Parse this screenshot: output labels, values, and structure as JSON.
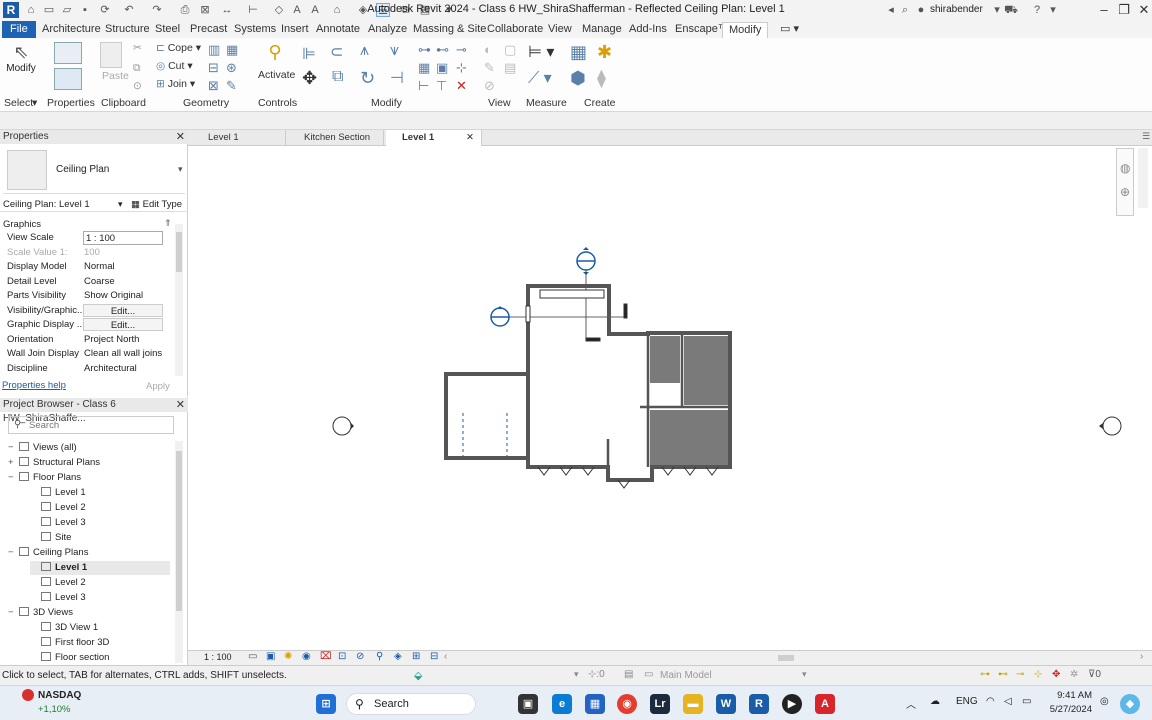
{
  "window": {
    "title": "Autodesk Revit 2024 - Class 6 HW_ShiraShafferman - Reflected Ceiling Plan: Level 1",
    "user": "shirabender"
  },
  "ribbon_tabs": [
    "File",
    "Architecture",
    "Structure",
    "Steel",
    "Precast",
    "Systems",
    "Insert",
    "Annotate",
    "Analyze",
    "Massing & Site",
    "Collaborate",
    "View",
    "Manage",
    "Add-Ins",
    "Enscape™",
    "Modify"
  ],
  "ribbon": {
    "select": {
      "label": "Select",
      "modify": "Modify"
    },
    "properties": "Properties",
    "clipboard": {
      "label": "Clipboard",
      "paste": "Paste"
    },
    "geometry": {
      "label": "Geometry",
      "cope": "Cope",
      "cut": "Cut",
      "join": "Join"
    },
    "controls": {
      "label": "Controls",
      "activate": "Activate"
    },
    "modify": "Modify",
    "view": "View",
    "measure": "Measure",
    "create": "Create"
  },
  "properties": {
    "header": "Properties",
    "type_name": "Ceiling Plan",
    "instance": "Ceiling Plan: Level 1",
    "edit_type": "Edit Type",
    "section": "Graphics",
    "rows": [
      {
        "k": "View Scale",
        "v": "1 : 100"
      },
      {
        "k": "Scale Value    1:",
        "v": "100"
      },
      {
        "k": "Display Model",
        "v": "Normal"
      },
      {
        "k": "Detail Level",
        "v": "Coarse"
      },
      {
        "k": "Parts Visibility",
        "v": "Show Original"
      },
      {
        "k": "Visibility/Graphic...",
        "v": "Edit..."
      },
      {
        "k": "Graphic Display ...",
        "v": "Edit..."
      },
      {
        "k": "Orientation",
        "v": "Project North"
      },
      {
        "k": "Wall Join Display",
        "v": "Clean all wall joins"
      },
      {
        "k": "Discipline",
        "v": "Architectural"
      }
    ],
    "help": "Properties help",
    "apply": "Apply"
  },
  "browser": {
    "header": "Project Browser - Class 6 HW_ShiraShaffe...",
    "search_placeholder": "Search",
    "nodes": [
      {
        "label": "Views (all)",
        "sign": "−"
      },
      {
        "label": "Structural Plans",
        "sign": "+"
      },
      {
        "label": "Floor Plans",
        "sign": "−"
      },
      {
        "label": "Level 1",
        "sign": ""
      },
      {
        "label": "Level 2",
        "sign": ""
      },
      {
        "label": "Level 3",
        "sign": ""
      },
      {
        "label": "Site",
        "sign": ""
      },
      {
        "label": "Ceiling Plans",
        "sign": "−"
      },
      {
        "label": "Level 1",
        "sign": ""
      },
      {
        "label": "Level 2",
        "sign": ""
      },
      {
        "label": "Level 3",
        "sign": ""
      },
      {
        "label": "3D Views",
        "sign": "−"
      },
      {
        "label": "3D View 1",
        "sign": ""
      },
      {
        "label": "First floor 3D",
        "sign": ""
      },
      {
        "label": "Floor section",
        "sign": ""
      }
    ]
  },
  "view_tabs": [
    "Level 1",
    "Kitchen Section",
    "Level 1"
  ],
  "view_bar": {
    "scale": "1 : 100"
  },
  "status": {
    "hint": "Click to select, TAB for alternates, CTRL adds, SHIFT unselects.",
    "zero": ":0",
    "model": "Main Model",
    "filter": "0"
  },
  "taskbar": {
    "stock": "NASDAQ",
    "change": "+1,10%",
    "search": "Search",
    "lang": "ENG",
    "time": "9:41 AM",
    "date": "5/27/2024"
  }
}
